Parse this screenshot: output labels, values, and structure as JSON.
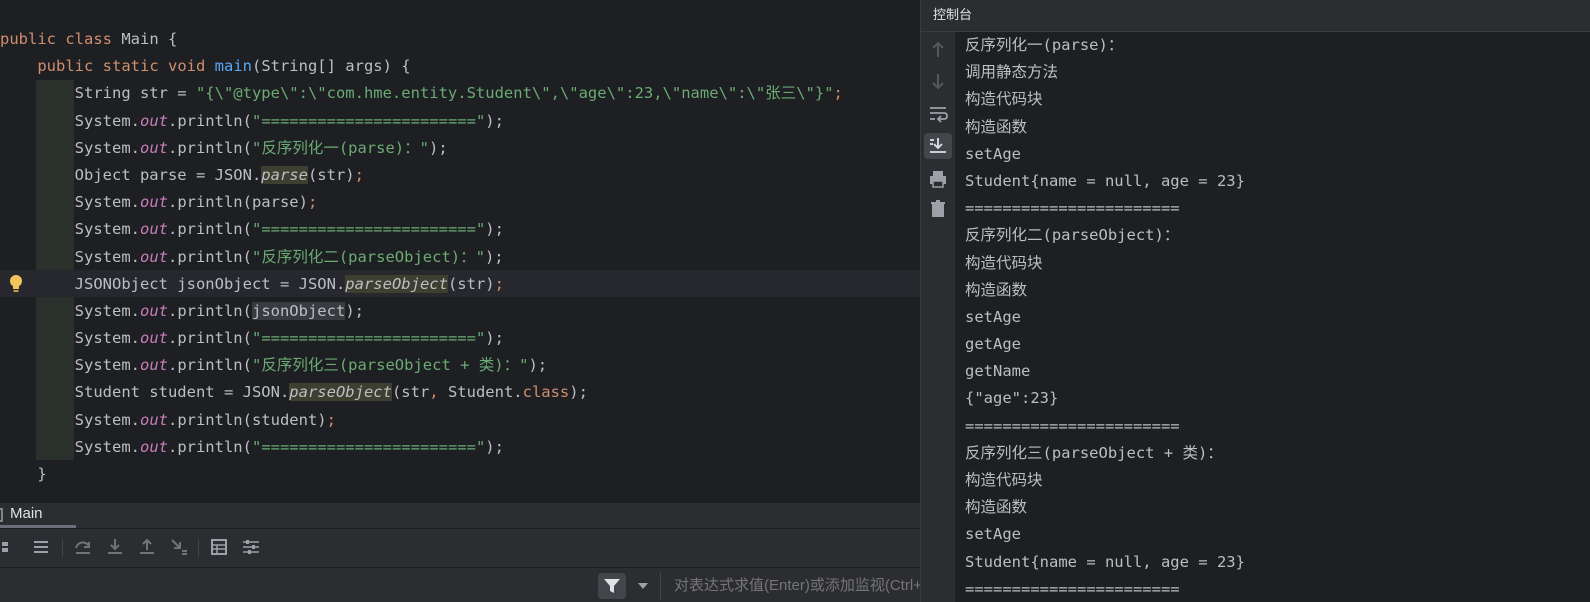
{
  "editor": {
    "tokens": [
      [
        [
          "public ",
          "kw"
        ],
        [
          "class ",
          "kw"
        ],
        [
          "Main {",
          ""
        ]
      ],
      [
        [
          "    ",
          ""
        ],
        [
          "public ",
          "kw"
        ],
        [
          "static ",
          "kw"
        ],
        [
          "void ",
          "kw"
        ],
        [
          "main",
          "fn"
        ],
        [
          "(String[] args) {",
          ""
        ]
      ],
      [
        [
          "        String str = ",
          ""
        ],
        [
          "\"{\\\"@type\\\":\\\"com.hme.entity.Student\\\",\\\"age\\\":23,\\\"name\\\":\\\"张三\\\"}\"",
          "str"
        ],
        [
          ";",
          "kw"
        ]
      ],
      [
        [
          "        System.",
          ""
        ],
        [
          "out",
          "st"
        ],
        [
          ".println(",
          ""
        ],
        [
          "\"=======================\"",
          "str"
        ],
        [
          ");",
          ""
        ]
      ],
      [
        [
          "        System.",
          ""
        ],
        [
          "out",
          "st"
        ],
        [
          ".println(",
          ""
        ],
        [
          "\"反序列化一(parse)：\"",
          "str"
        ],
        [
          ");",
          ""
        ]
      ],
      [
        [
          "        Object parse = JSON.",
          ""
        ],
        [
          "parse",
          "it hl"
        ],
        [
          "(str)",
          ""
        ],
        [
          ";",
          "kw"
        ]
      ],
      [
        [
          "        System.",
          ""
        ],
        [
          "out",
          "st"
        ],
        [
          ".println(parse)",
          ""
        ],
        [
          ";",
          "kw"
        ]
      ],
      [
        [
          "        System.",
          ""
        ],
        [
          "out",
          "st"
        ],
        [
          ".println(",
          ""
        ],
        [
          "\"=======================\"",
          "str"
        ],
        [
          ");",
          ""
        ]
      ],
      [
        [
          "        System.",
          ""
        ],
        [
          "out",
          "st"
        ],
        [
          ".println(",
          ""
        ],
        [
          "\"反序列化二(parseObject)：\"",
          "str"
        ],
        [
          ");",
          ""
        ]
      ],
      [
        [
          "        JSONObject jsonObject ",
          ""
        ],
        [
          "= JSON.",
          ""
        ],
        [
          "parseObject",
          "it hl"
        ],
        [
          "(str)",
          ""
        ],
        [
          ";",
          "kw"
        ]
      ],
      [
        [
          "        System.",
          ""
        ],
        [
          "out",
          "st"
        ],
        [
          ".println(",
          ""
        ],
        [
          "jsonObject",
          "hlb"
        ],
        [
          ");",
          ""
        ]
      ],
      [
        [
          "        System.",
          ""
        ],
        [
          "out",
          "st"
        ],
        [
          ".println(",
          ""
        ],
        [
          "\"=======================\"",
          "str"
        ],
        [
          ");",
          ""
        ]
      ],
      [
        [
          "        System.",
          ""
        ],
        [
          "out",
          "st"
        ],
        [
          ".println(",
          ""
        ],
        [
          "\"反序列化三(parseObject + 类)：\"",
          "str"
        ],
        [
          ");",
          ""
        ]
      ],
      [
        [
          "        Student student = JSON.",
          ""
        ],
        [
          "parseObject",
          "it hl"
        ],
        [
          "(str",
          ""
        ],
        [
          ", ",
          "kw"
        ],
        [
          "Student.",
          ""
        ],
        [
          "class",
          "kw"
        ],
        [
          ");",
          ""
        ]
      ],
      [
        [
          "        System.",
          ""
        ],
        [
          "out",
          "st"
        ],
        [
          ".println(student)",
          ""
        ],
        [
          ";",
          "kw"
        ]
      ],
      [
        [
          "        System.",
          ""
        ],
        [
          "out",
          "st"
        ],
        [
          ".println(",
          ""
        ],
        [
          "\"=======================\"",
          "str"
        ],
        [
          ");",
          ""
        ]
      ],
      [
        [
          "    }",
          ""
        ]
      ]
    ]
  },
  "debug": {
    "tab_label": "Main",
    "eval_placeholder": "对表达式求值(Enter)或添加监视(Ctrl+Shift+Enter)"
  },
  "console": {
    "title": "控制台",
    "lines": [
      "反序列化一(parse)：",
      "调用静态方法",
      "构造代码块",
      "构造函数",
      "setAge",
      "Student{name = null, age = 23}",
      "=======================",
      "反序列化二(parseObject)：",
      "构造代码块",
      "构造函数",
      "setAge",
      "getAge",
      "getName",
      "{\"age\":23}",
      "=======================",
      "反序列化三(parseObject + 类)：",
      "构造代码块",
      "构造函数",
      "setAge",
      "Student{name = null, age = 23}",
      "======================="
    ]
  },
  "colors": {
    "keyword": "#cf8e6d",
    "string": "#6aab73",
    "function": "#56a8f5",
    "static_field": "#c77dbb",
    "text": "#bcbec4",
    "background": "#1e1f22"
  }
}
